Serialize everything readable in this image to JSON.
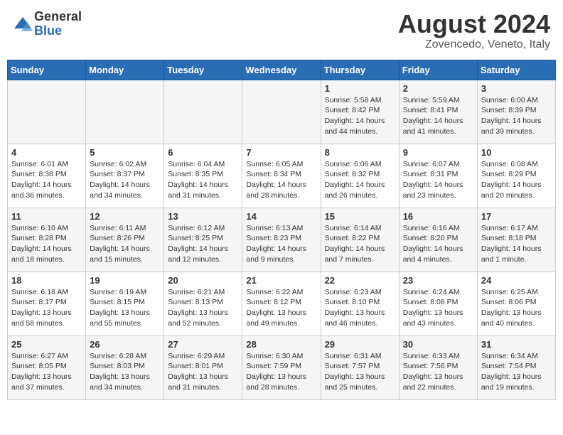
{
  "header": {
    "logo_general": "General",
    "logo_blue": "Blue",
    "title": "August 2024",
    "subtitle": "Zovencedo, Veneto, Italy"
  },
  "weekdays": [
    "Sunday",
    "Monday",
    "Tuesday",
    "Wednesday",
    "Thursday",
    "Friday",
    "Saturday"
  ],
  "weeks": [
    [
      {
        "day": "",
        "info": ""
      },
      {
        "day": "",
        "info": ""
      },
      {
        "day": "",
        "info": ""
      },
      {
        "day": "",
        "info": ""
      },
      {
        "day": "1",
        "info": "Sunrise: 5:58 AM\nSunset: 8:42 PM\nDaylight: 14 hours\nand 44 minutes."
      },
      {
        "day": "2",
        "info": "Sunrise: 5:59 AM\nSunset: 8:41 PM\nDaylight: 14 hours\nand 41 minutes."
      },
      {
        "day": "3",
        "info": "Sunrise: 6:00 AM\nSunset: 8:39 PM\nDaylight: 14 hours\nand 39 minutes."
      }
    ],
    [
      {
        "day": "4",
        "info": "Sunrise: 6:01 AM\nSunset: 8:38 PM\nDaylight: 14 hours\nand 36 minutes."
      },
      {
        "day": "5",
        "info": "Sunrise: 6:02 AM\nSunset: 8:37 PM\nDaylight: 14 hours\nand 34 minutes."
      },
      {
        "day": "6",
        "info": "Sunrise: 6:04 AM\nSunset: 8:35 PM\nDaylight: 14 hours\nand 31 minutes."
      },
      {
        "day": "7",
        "info": "Sunrise: 6:05 AM\nSunset: 8:34 PM\nDaylight: 14 hours\nand 28 minutes."
      },
      {
        "day": "8",
        "info": "Sunrise: 6:06 AM\nSunset: 8:32 PM\nDaylight: 14 hours\nand 26 minutes."
      },
      {
        "day": "9",
        "info": "Sunrise: 6:07 AM\nSunset: 8:31 PM\nDaylight: 14 hours\nand 23 minutes."
      },
      {
        "day": "10",
        "info": "Sunrise: 6:08 AM\nSunset: 8:29 PM\nDaylight: 14 hours\nand 20 minutes."
      }
    ],
    [
      {
        "day": "11",
        "info": "Sunrise: 6:10 AM\nSunset: 8:28 PM\nDaylight: 14 hours\nand 18 minutes."
      },
      {
        "day": "12",
        "info": "Sunrise: 6:11 AM\nSunset: 8:26 PM\nDaylight: 14 hours\nand 15 minutes."
      },
      {
        "day": "13",
        "info": "Sunrise: 6:12 AM\nSunset: 8:25 PM\nDaylight: 14 hours\nand 12 minutes."
      },
      {
        "day": "14",
        "info": "Sunrise: 6:13 AM\nSunset: 8:23 PM\nDaylight: 14 hours\nand 9 minutes."
      },
      {
        "day": "15",
        "info": "Sunrise: 6:14 AM\nSunset: 8:22 PM\nDaylight: 14 hours\nand 7 minutes."
      },
      {
        "day": "16",
        "info": "Sunrise: 6:16 AM\nSunset: 8:20 PM\nDaylight: 14 hours\nand 4 minutes."
      },
      {
        "day": "17",
        "info": "Sunrise: 6:17 AM\nSunset: 8:18 PM\nDaylight: 14 hours\nand 1 minute."
      }
    ],
    [
      {
        "day": "18",
        "info": "Sunrise: 6:18 AM\nSunset: 8:17 PM\nDaylight: 13 hours\nand 58 minutes."
      },
      {
        "day": "19",
        "info": "Sunrise: 6:19 AM\nSunset: 8:15 PM\nDaylight: 13 hours\nand 55 minutes."
      },
      {
        "day": "20",
        "info": "Sunrise: 6:21 AM\nSunset: 8:13 PM\nDaylight: 13 hours\nand 52 minutes."
      },
      {
        "day": "21",
        "info": "Sunrise: 6:22 AM\nSunset: 8:12 PM\nDaylight: 13 hours\nand 49 minutes."
      },
      {
        "day": "22",
        "info": "Sunrise: 6:23 AM\nSunset: 8:10 PM\nDaylight: 13 hours\nand 46 minutes."
      },
      {
        "day": "23",
        "info": "Sunrise: 6:24 AM\nSunset: 8:08 PM\nDaylight: 13 hours\nand 43 minutes."
      },
      {
        "day": "24",
        "info": "Sunrise: 6:25 AM\nSunset: 8:06 PM\nDaylight: 13 hours\nand 40 minutes."
      }
    ],
    [
      {
        "day": "25",
        "info": "Sunrise: 6:27 AM\nSunset: 8:05 PM\nDaylight: 13 hours\nand 37 minutes."
      },
      {
        "day": "26",
        "info": "Sunrise: 6:28 AM\nSunset: 8:03 PM\nDaylight: 13 hours\nand 34 minutes."
      },
      {
        "day": "27",
        "info": "Sunrise: 6:29 AM\nSunset: 8:01 PM\nDaylight: 13 hours\nand 31 minutes."
      },
      {
        "day": "28",
        "info": "Sunrise: 6:30 AM\nSunset: 7:59 PM\nDaylight: 13 hours\nand 28 minutes."
      },
      {
        "day": "29",
        "info": "Sunrise: 6:31 AM\nSunset: 7:57 PM\nDaylight: 13 hours\nand 25 minutes."
      },
      {
        "day": "30",
        "info": "Sunrise: 6:33 AM\nSunset: 7:56 PM\nDaylight: 13 hours\nand 22 minutes."
      },
      {
        "day": "31",
        "info": "Sunrise: 6:34 AM\nSunset: 7:54 PM\nDaylight: 13 hours\nand 19 minutes."
      }
    ]
  ]
}
